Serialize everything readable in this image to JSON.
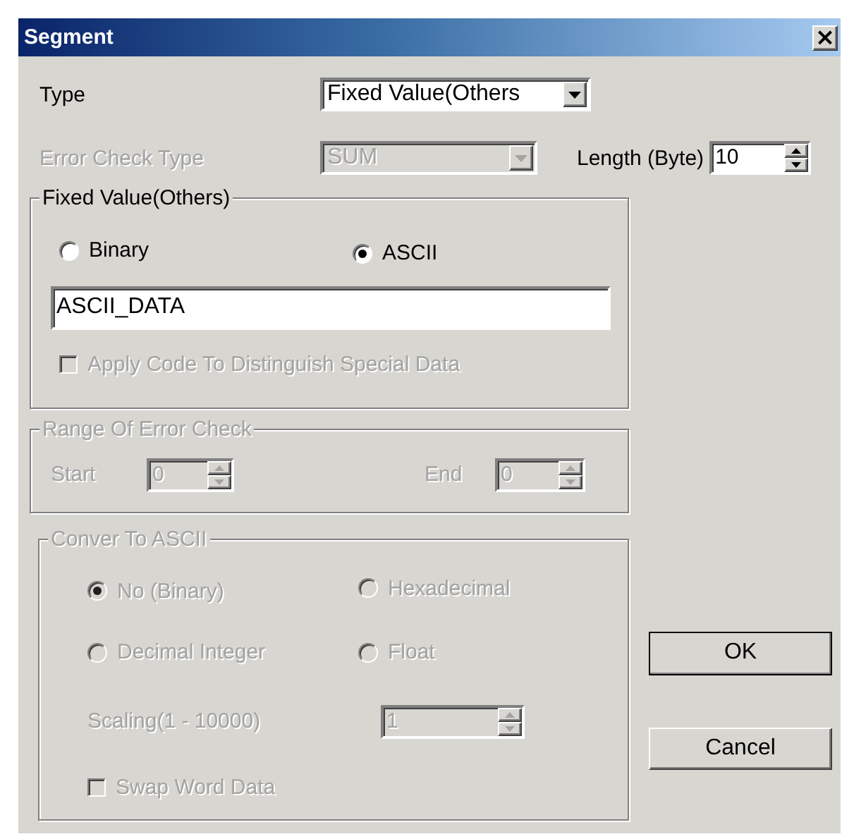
{
  "window": {
    "title": "Segment",
    "close": "×"
  },
  "type_field": {
    "label": "Type",
    "value": "Fixed Value(Others",
    "disabled": false
  },
  "error_check_type": {
    "label": "Error Check Type",
    "value": "SUM",
    "disabled": true
  },
  "length": {
    "label": "Length (Byte)",
    "value": "10",
    "disabled": false
  },
  "fixed_value_group": {
    "title": "Fixed Value(Others)",
    "disabled": false,
    "options": [
      {
        "label": "Binary",
        "selected": false
      },
      {
        "label": "ASCII",
        "selected": true
      }
    ],
    "data_field": {
      "value": "ASCII_DATA"
    },
    "apply_code": {
      "label": "Apply Code To Distinguish Special Data",
      "checked": false,
      "disabled": true
    }
  },
  "range_group": {
    "title": "Range Of Error Check",
    "disabled": true,
    "start": {
      "label": "Start",
      "value": "0"
    },
    "end": {
      "label": "End",
      "value": "0"
    }
  },
  "convert_group": {
    "title": "Conver To ASCII",
    "disabled": true,
    "options": [
      {
        "label": "No (Binary)",
        "selected": true
      },
      {
        "label": "Hexadecimal",
        "selected": false
      },
      {
        "label": "Decimal Integer",
        "selected": false
      },
      {
        "label": "Float",
        "selected": false
      }
    ],
    "scaling": {
      "label": "Scaling(1 - 10000)",
      "value": "1"
    },
    "swap": {
      "label": "Swap Word Data",
      "checked": false
    }
  },
  "buttons": [
    {
      "label": "OK",
      "default": true
    },
    {
      "label": "Cancel",
      "default": false
    }
  ]
}
